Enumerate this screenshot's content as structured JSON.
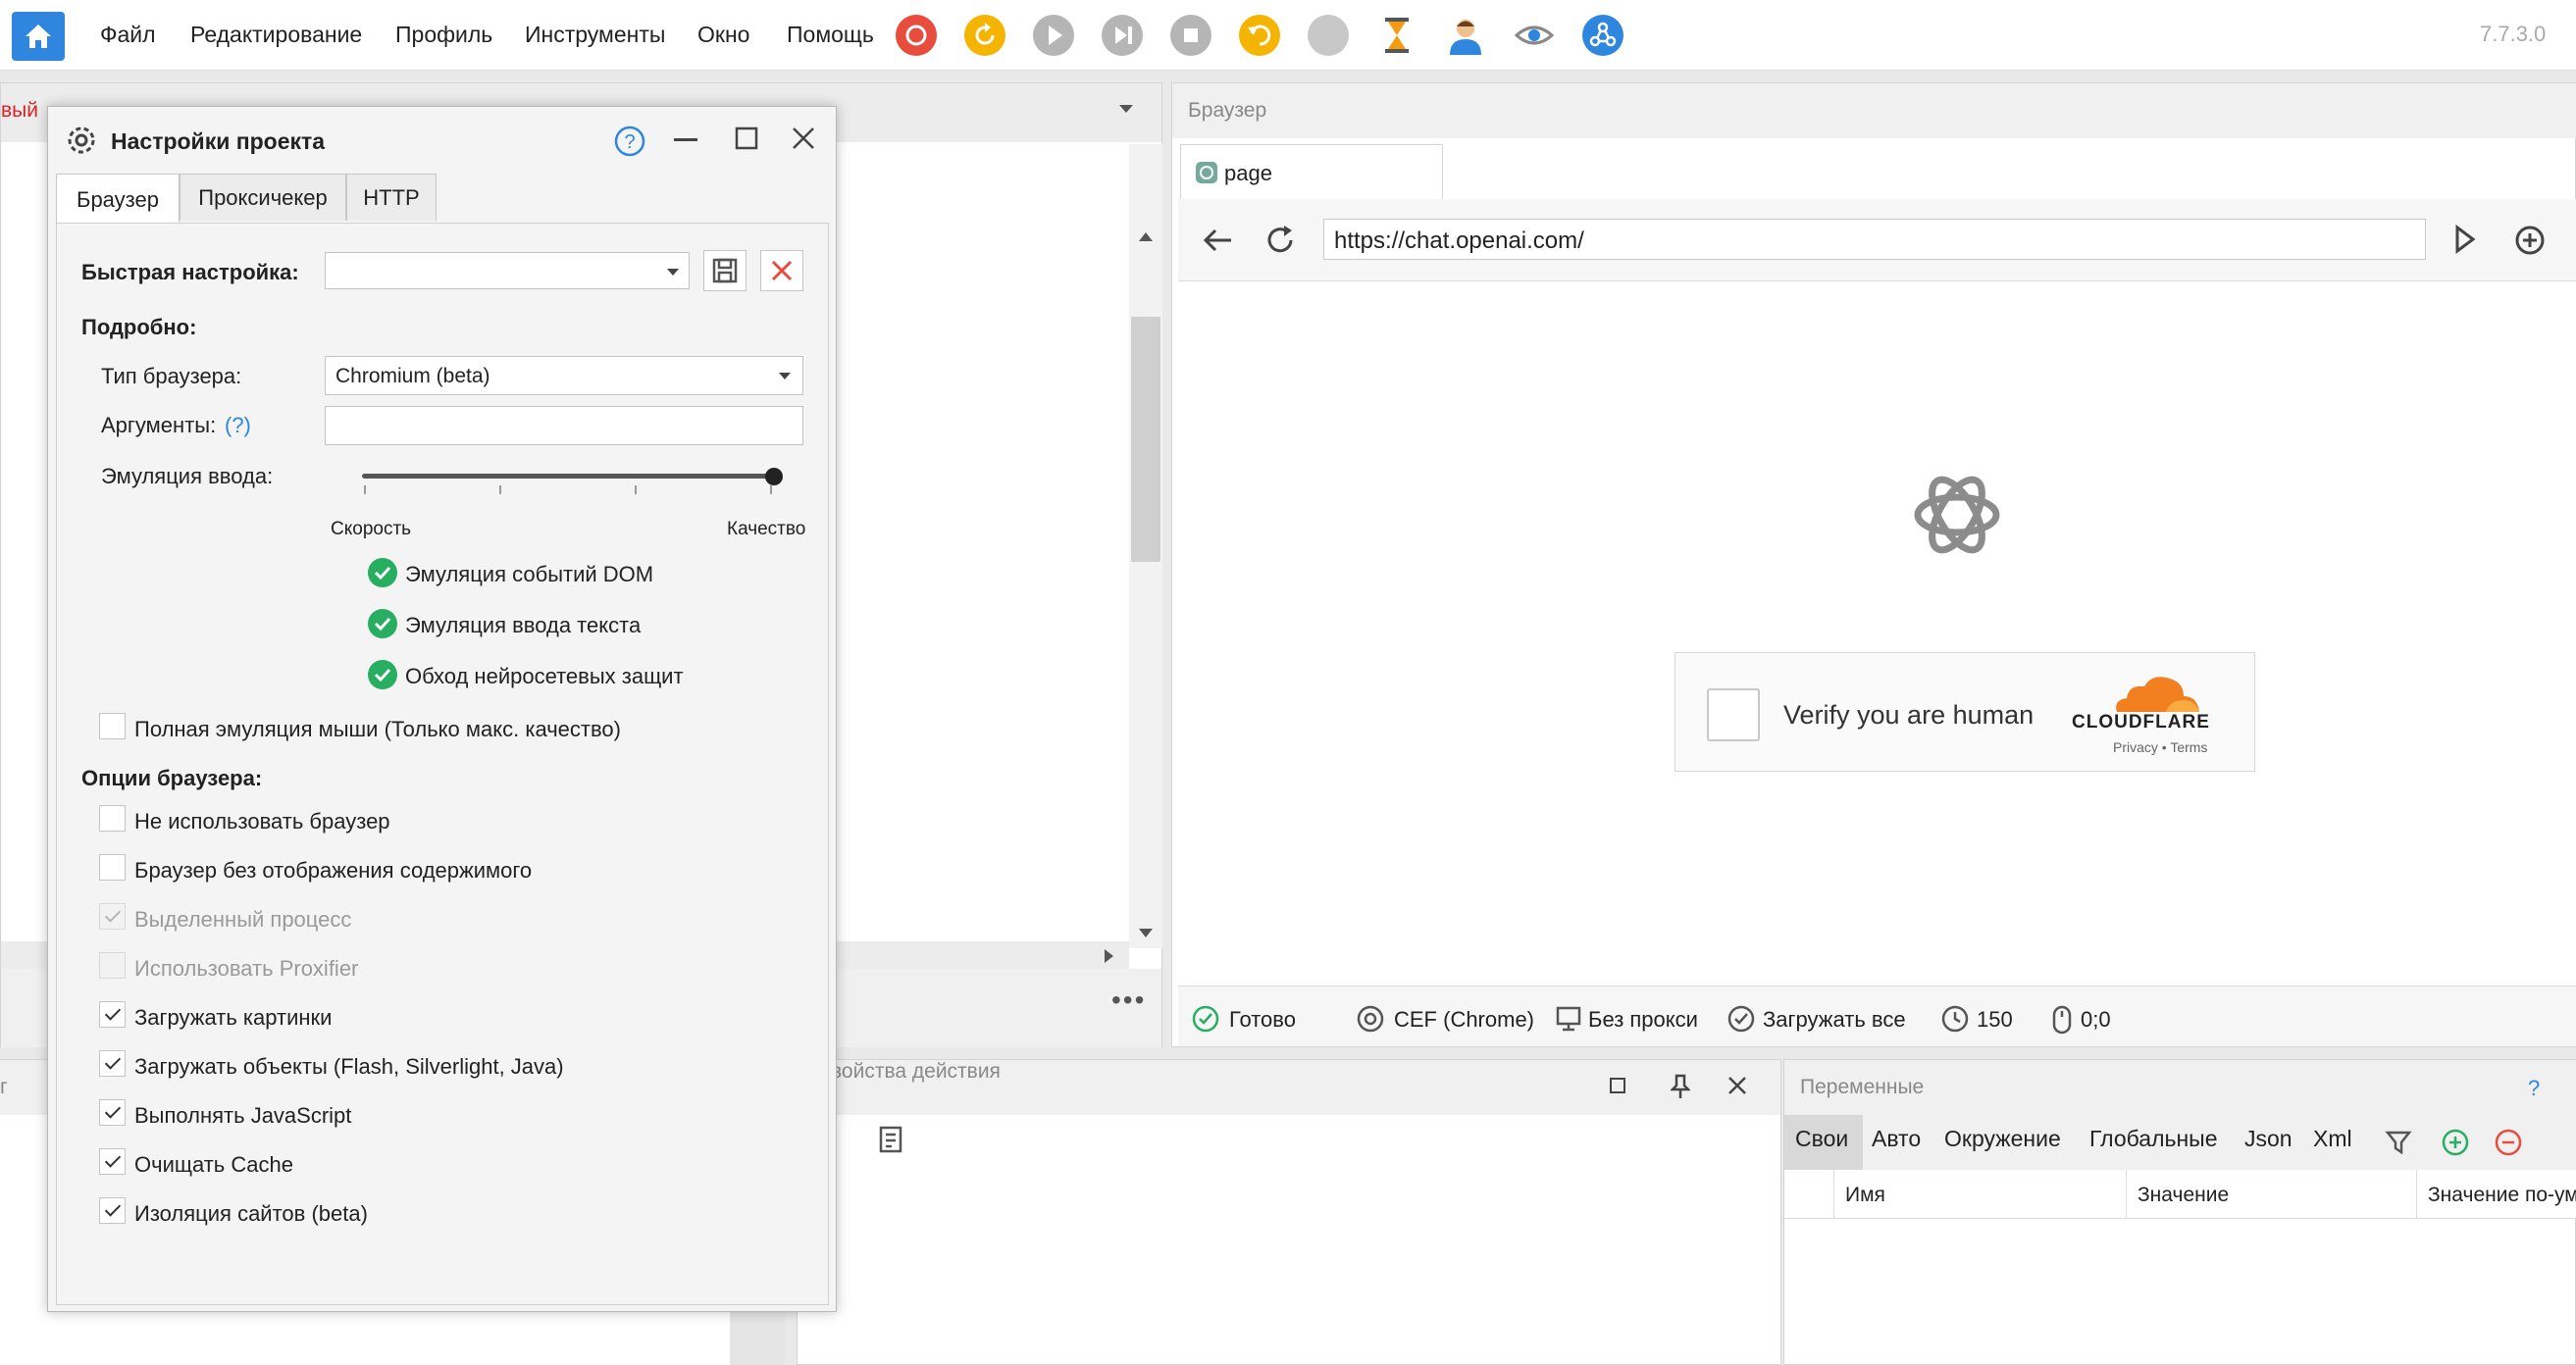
{
  "app": {
    "menu": [
      "Файл",
      "Редактирование",
      "Профиль",
      "Инструменты",
      "Окно",
      "Помощь"
    ],
    "version": "7.7.3.0"
  },
  "colors": {
    "accent": "#2e86de",
    "record": "#e74c3c",
    "orange": "#f4b400",
    "green": "#27ae60",
    "cloudflare": "#f38020"
  },
  "left_tab_fragment": "вый",
  "dialog": {
    "title": "Настройки проекта",
    "tabs": [
      "Браузер",
      "Проксичекер",
      "HTTP"
    ],
    "quick_setup_label": "Быстрая настройка:",
    "quick_setup_value": "",
    "details_label": "Подробно:",
    "browser_type_label": "Тип браузера:",
    "browser_type_value": "Chromium (beta)",
    "arguments_label": "Аргументы:",
    "arguments_help": "(?)",
    "arguments_value": "",
    "input_emulation_label": "Эмуляция ввода:",
    "slider_min_label": "Скорость",
    "slider_max_label": "Качество",
    "slider_level": 1.0,
    "emulation_checks": [
      "Эмуляция событий DOM",
      "Эмуляция ввода текста",
      "Обход нейросетевых защит"
    ],
    "full_mouse_label": "Полная эмуляция мыши (Только макс. качество)",
    "browser_options_label": "Опции браузера:",
    "options": [
      {
        "label": "Не использовать браузер",
        "checked": false,
        "disabled": false
      },
      {
        "label": "Браузер без отображения содержимого",
        "checked": false,
        "disabled": false
      },
      {
        "label": "Выделенный процесс",
        "checked": true,
        "disabled": true
      },
      {
        "label": "Использовать Proxifier",
        "checked": false,
        "disabled": true
      },
      {
        "label": "Загружать картинки",
        "checked": true,
        "disabled": false
      },
      {
        "label": "Загружать объекты (Flash, Silverlight, Java)",
        "checked": true,
        "disabled": false
      },
      {
        "label": "Выполнять JavaScript",
        "checked": true,
        "disabled": false
      },
      {
        "label": "Очищать Cache",
        "checked": true,
        "disabled": false
      },
      {
        "label": "Изоляция сайтов (beta)",
        "checked": true,
        "disabled": false
      }
    ]
  },
  "browser": {
    "panel_title": "Браузер",
    "tab_title": "page",
    "url": "https://chat.openai.com/",
    "captcha_text": "Verify you are human",
    "cloudflare_brand": "CLOUDFLARE",
    "cloudflare_links": "Privacy  •  Terms",
    "status": {
      "ready": "Готово",
      "engine": "CEF (Chrome)",
      "proxy": "Без прокси",
      "load": "Загружать все",
      "timeout": "150",
      "coords": "0;0"
    }
  },
  "action_props": {
    "title": "войства действия"
  },
  "left_bottom_fragment": "г",
  "variables": {
    "title": "Переменные",
    "help": "?",
    "tabs": [
      "Свои",
      "Авто",
      "Окружение",
      "Глобальные",
      "Json",
      "Xml"
    ],
    "columns": [
      "Имя",
      "Значение",
      "Значение по-ум"
    ]
  }
}
